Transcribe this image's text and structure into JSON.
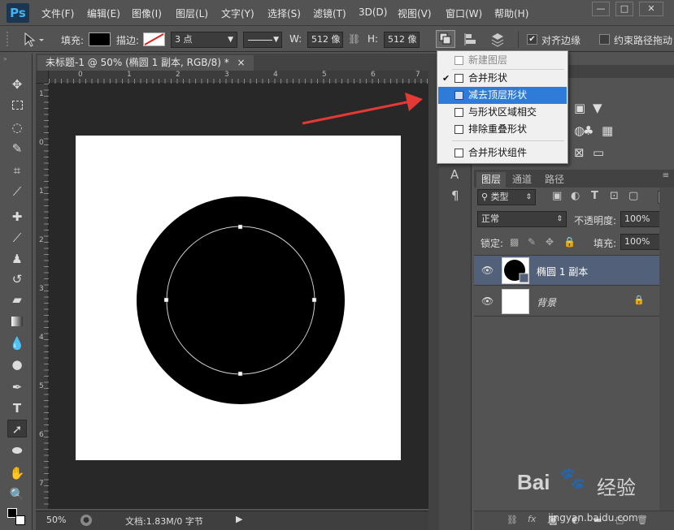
{
  "app": {
    "logo": "Ps"
  },
  "menubar": {
    "items": [
      "文件(F)",
      "编辑(E)",
      "图像(I)",
      "图层(L)",
      "文字(Y)",
      "选择(S)",
      "滤镜(T)",
      "3D(D)",
      "视图(V)",
      "窗口(W)",
      "帮助(H)"
    ],
    "win_minimize": "—",
    "win_restore": "□",
    "win_close": "✕"
  },
  "options": {
    "fill_label": "填充:",
    "stroke_label": "描边:",
    "stroke_width": "3 点",
    "w_label": "W:",
    "w_value": "512 像",
    "h_label": "H:",
    "h_value": "512 像",
    "align_edges": "对齐边缘",
    "constrain_path": "约束路径拖动"
  },
  "document": {
    "tab_title": "未标题-1 @ 50% (椭圆 1 副本, RGB/8) *",
    "tab_close": "×",
    "ruler_top": [
      "0",
      "1",
      "2",
      "3",
      "4",
      "5",
      "6",
      "7"
    ],
    "ruler_left": [
      "1",
      "0",
      "1",
      "2",
      "3",
      "4",
      "5",
      "6",
      "7"
    ],
    "zoom": "50%",
    "doc_info": "文档:1.83M/0 字节"
  },
  "dropdown": {
    "items": [
      {
        "label": "新建图层",
        "disabled": true
      },
      {
        "label": "合并形状",
        "checked": true
      },
      {
        "label": "减去顶层形状",
        "selected": true
      },
      {
        "label": "与形状区域相交"
      },
      {
        "label": "排除重叠形状"
      },
      {
        "label": "合并形状组件"
      }
    ],
    "check": "✔"
  },
  "panel": {
    "tabs": [
      "图层",
      "通道",
      "路径"
    ],
    "filter_kind": "类型",
    "blend_mode": "正常",
    "opacity_label": "不透明度:",
    "opacity_value": "100%",
    "lock_label": "锁定:",
    "fill_label": "填充:",
    "fill_value": "100%",
    "layers": [
      {
        "name": "椭圆 1 副本",
        "selected": true
      },
      {
        "name": "背景",
        "locked": true
      }
    ],
    "bottom_icons": [
      "link-icon",
      "fx-icon",
      "mask-icon",
      "adjustment-icon",
      "folder-icon",
      "new-layer-icon",
      "trash-icon"
    ]
  },
  "watermark": {
    "brand": "Bai",
    "brand2": "经验",
    "url": "jingyan.baidu.com"
  },
  "colors": {
    "ui_bg": "#535353",
    "canvas_bg": "#282828",
    "selection": "#2f7bd8",
    "arrow": "#e53935",
    "ps_blue": "#3fb3f4"
  }
}
